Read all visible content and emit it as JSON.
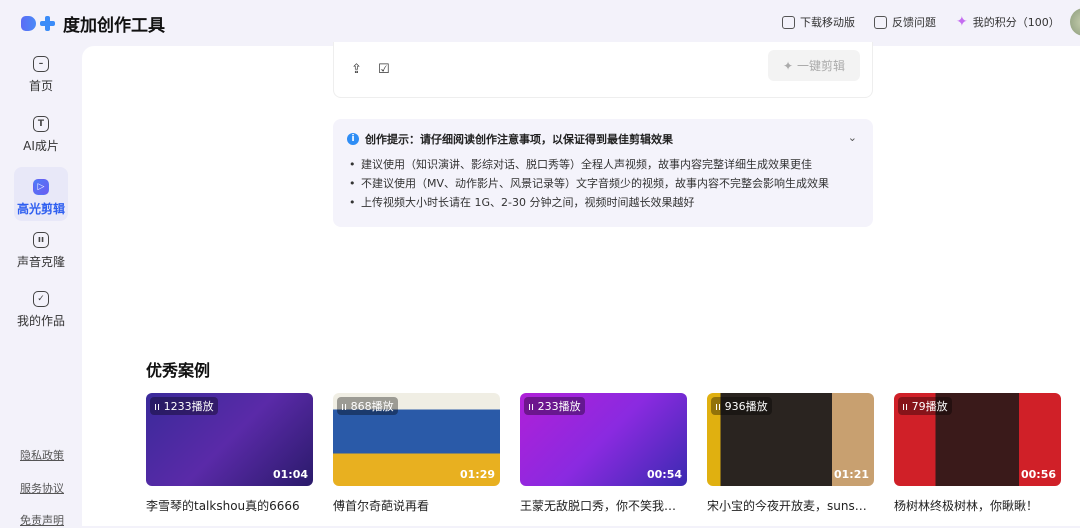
{
  "header": {
    "app_name": "度加创作工具",
    "download": "下载移动版",
    "feedback": "反馈问题",
    "points": "我的积分（100）"
  },
  "sidebar": {
    "items": [
      {
        "label": "首页",
        "icon": "home-icon"
      },
      {
        "label": "AI成片",
        "icon": "text-icon"
      },
      {
        "label": "高光剪辑",
        "icon": "play-icon",
        "active": true
      },
      {
        "label": "声音克隆",
        "icon": "voice-icon"
      },
      {
        "label": "我的作品",
        "icon": "folder-check-icon"
      }
    ],
    "footer": [
      "隐私政策",
      "服务协议",
      "免责声明"
    ]
  },
  "upload": {
    "one_click_edit": "一键剪辑"
  },
  "tip": {
    "title": "创作提示：请仔细阅读创作注意事项，以保证得到最佳剪辑效果",
    "items": [
      "建议使用（知识演讲、影综对话、脱口秀等）全程人声视频，故事内容完整详细生成效果更佳",
      "不建议使用（MV、动作影片、风景记录等）文字音频少的视频，故事内容不完整会影响生成效果",
      "上传视频大小时长请在 1G、2-30 分钟之间，视频时间越长效果越好"
    ]
  },
  "showcase": {
    "title": "优秀案例",
    "cards": [
      {
        "plays": "1233播放",
        "duration": "01:04",
        "title": "李雪琴的talkshou真的6666"
      },
      {
        "plays": "868播放",
        "duration": "01:29",
        "title": "傅首尔奇葩说再看"
      },
      {
        "plays": "233播放",
        "duration": "00:54",
        "title": "王蒙无敌脱口秀，你不笑我笑你"
      },
      {
        "plays": "936播放",
        "duration": "01:21",
        "title": "宋小宝的今夜开放麦，sunsai..."
      },
      {
        "plays": "79播放",
        "duration": "00:56",
        "title": "杨树林终极树林，你瞅瞅！"
      }
    ]
  },
  "colors": {
    "accent": "#2f5ff0",
    "background": "#f3f2fa"
  }
}
